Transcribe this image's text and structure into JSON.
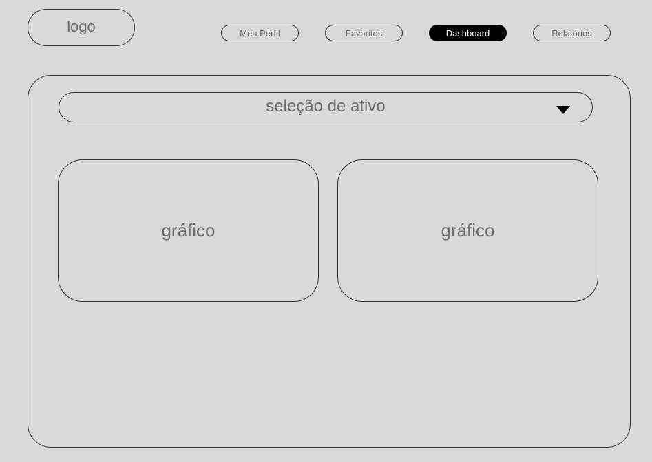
{
  "header": {
    "logo_text": "logo",
    "nav": [
      {
        "label": "Meu Perfil",
        "active": false
      },
      {
        "label": "Favoritos",
        "active": false
      },
      {
        "label": "Dashboard",
        "active": true
      },
      {
        "label": "Relatórios",
        "active": false
      }
    ]
  },
  "main": {
    "asset_select": {
      "label": "seleção de ativo",
      "icon": "caret-down-icon"
    },
    "charts": [
      {
        "label": "gráfico"
      },
      {
        "label": "gráfico"
      }
    ]
  },
  "colors": {
    "background": "#d9d9d9",
    "border": "#333333",
    "text": "#6b6b6b",
    "active_bg": "#000000",
    "active_text": "#ffffff"
  }
}
